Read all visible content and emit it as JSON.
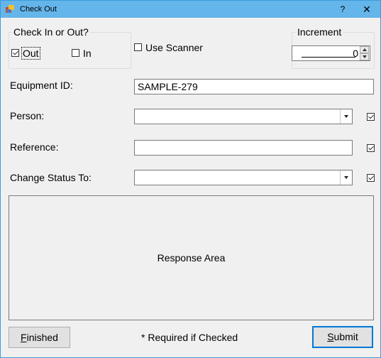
{
  "window": {
    "title": "Check Out",
    "help_label": "?",
    "close_label": "✕",
    "icon": "app-icon"
  },
  "check_group": {
    "title": "Check In or Out?",
    "out_label": "Out",
    "out_checked": true,
    "in_label": "In",
    "in_checked": false
  },
  "scanner": {
    "label": "Use Scanner",
    "checked": false
  },
  "increment": {
    "title": "Increment",
    "value": "0"
  },
  "fields": {
    "equipment_label": "Equipment ID:",
    "equipment_value": "SAMPLE-279",
    "person_label": "Person:",
    "person_value": "",
    "person_required": true,
    "reference_label": "Reference:",
    "reference_value": "",
    "reference_required": true,
    "status_label": "Change Status To:",
    "status_value": "",
    "status_required": true
  },
  "response": {
    "text": "Response Area"
  },
  "footer": {
    "finished_label": "Finished",
    "note": "* Required if Checked",
    "submit_label": "Submit"
  }
}
